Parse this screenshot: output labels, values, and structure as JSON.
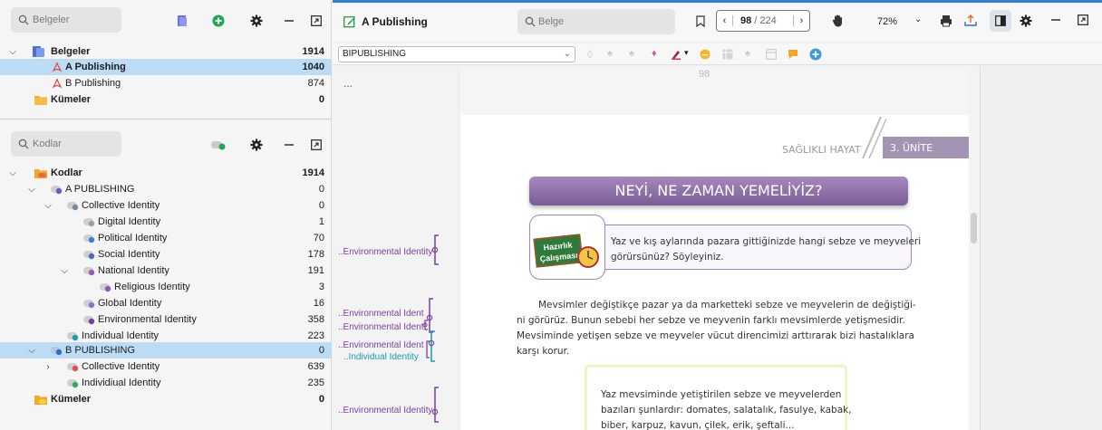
{
  "documents_panel": {
    "search_placeholder": "Belgeler",
    "root": {
      "label": "Belgeler",
      "count": "1914"
    },
    "items": [
      {
        "label": "A Publishing",
        "count": "1040"
      },
      {
        "label": "B Publishing",
        "count": "874"
      }
    ],
    "sets": {
      "label": "Kümeler",
      "count": "0"
    }
  },
  "codes_panel": {
    "search_placeholder": "Kodlar",
    "root": {
      "label": "Kodlar",
      "count": "1914"
    },
    "rows": [
      {
        "label": "A PUBLISHING",
        "count": "0"
      },
      {
        "label": "Collective Identity",
        "count": "0"
      },
      {
        "label": "Digital Identity",
        "count": "1"
      },
      {
        "label": "Political Identity",
        "count": "70"
      },
      {
        "label": "Social Identity",
        "count": "178"
      },
      {
        "label": "National Identity",
        "count": "191"
      },
      {
        "label": "Religious Identity",
        "count": "3"
      },
      {
        "label": "Global Identity",
        "count": "16"
      },
      {
        "label": "Environmental Identity",
        "count": "358"
      },
      {
        "label": "Individual Identity",
        "count": "223"
      },
      {
        "label": "B PUBLISHING",
        "count": "0"
      },
      {
        "label": "Collective Identity",
        "count": "639"
      },
      {
        "label": "Individiual Identity",
        "count": "235"
      }
    ],
    "sets": {
      "label": "Kümeler",
      "count": "0"
    }
  },
  "viewer": {
    "title": "A Publishing",
    "search_placeholder": "Belge",
    "page_current": "98",
    "page_total": "/ 224",
    "zoom": "72%",
    "document_select": "BIPUBLISHING",
    "more_label": "..."
  },
  "margin_codes": [
    "..Environmental Identity",
    "..Environmental Ident",
    "..Environmental Ident",
    "..Environmental Ident",
    "..Individual Identity",
    "..Environmental Identity"
  ],
  "page": {
    "page_number": "98",
    "unit_title": "SAĞLIKLI HAYAT",
    "unit_number": "3. ÜNİTE",
    "lesson_title": "NEYİ, NE ZAMAN YEMELİYİZ?",
    "warmup_badge_line1": "Hazırlık",
    "warmup_badge_line2": "Çalışması",
    "warmup_text_1": "Yaz ve kış aylarında pazara gittiğinizde hangi sebze ve meyveleri",
    "warmup_text_2": "görürsünüz? Söyleyiniz.",
    "para_1": "Mevsimler değiştikçe pazar ya da marketteki sebze ve meyvelerin de değiştiği-",
    "para_2": "ni görürüz. Bunun sebebi her sebze ve meyvenin farklı mevsimlerde yetişmesidir.",
    "para_3": "Mevsiminde yetişen sebze ve meyveler vücut direncimizi arttırarak bizi hastalıklara",
    "para_4": "karşı korur.",
    "box_1": "Yaz mevsiminde yetiştirilen  sebze ve meyvelerden",
    "box_2": "bazıları şunlardır: domates, salatalık, fasulye, kabak,",
    "box_3": "biber, karpuz, kavun, çilek, erik, şeftali..."
  },
  "colors": {
    "accent_blue": "#2f7fd8",
    "selection": "#bcdcf5",
    "code_purple": "#7a3fa0",
    "code_teal": "#1b9ab0",
    "title_banner": "#8e6fa8",
    "unit_band": "#a394b3",
    "folder_orange": "#f4a72a"
  }
}
